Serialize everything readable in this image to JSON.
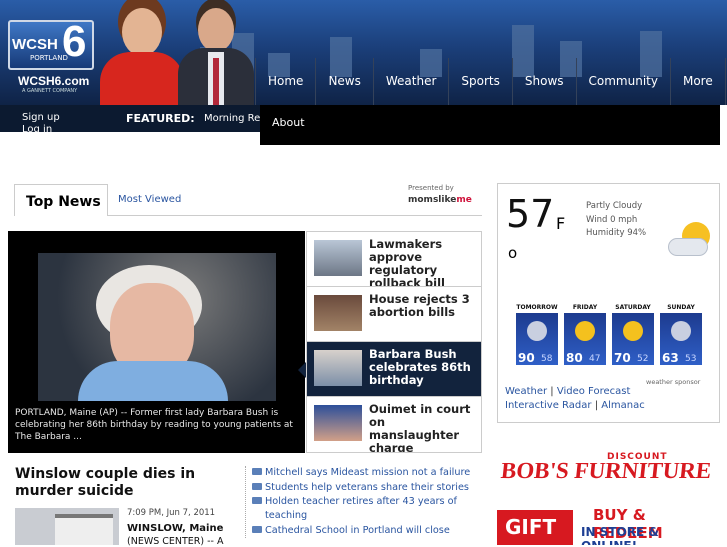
{
  "header": {
    "call_letters": "WCSH",
    "channel": "6",
    "city": "PORTLAND",
    "url": "WCSH6.com",
    "company": "A GANNETT COMPANY"
  },
  "nav": {
    "items": [
      "Home",
      "News",
      "Weather",
      "Sports",
      "Shows",
      "Community",
      "More"
    ],
    "submenu_item": "About"
  },
  "topbar": {
    "signup": "Sign up",
    "login": "Log in",
    "featured_label": "FEATURED:",
    "featured_item": "Morning Rep"
  },
  "tabs": {
    "top_news": "Top News",
    "most_viewed": "Most Viewed",
    "presented_by": "Presented by",
    "sponsor": "momslike",
    "sponsor_suffix": "me"
  },
  "feature": {
    "caption": "PORTLAND, Maine (AP) -- Former first lady Barbara Bush is celebrating her 86th birthday by reading to young patients at The Barbara ..."
  },
  "headlines": [
    {
      "text": "Lawmakers approve regulatory rollback bill",
      "active": false
    },
    {
      "text": "House rejects 3 abortion bills",
      "active": false
    },
    {
      "text": "Barbara Bush celebrates 86th birthday",
      "active": true
    },
    {
      "text": "Ouimet in court on manslaughter charge",
      "active": false
    }
  ],
  "story": {
    "headline": "Winslow couple dies in murder suicide",
    "date": "7:09 PM, Jun 7, 2011",
    "location": "WINSLOW, Maine",
    "source": "(NEWS CENTER) -- A"
  },
  "links": [
    "Mitchell says Mideast mission not a failure",
    "Students help veterans share their stories",
    "Holden teacher retires after 43 years of teaching",
    "Cathedral School in Portland will close"
  ],
  "weather": {
    "temp": "57",
    "unit": "F",
    "degree": "o",
    "condition": "Partly Cloudy",
    "wind": "Wind 0 mph",
    "humidity": "Humidity 94%",
    "forecast": [
      {
        "day": "TOMORROW",
        "hi": "90",
        "lo": "58",
        "icon": "storm-icon"
      },
      {
        "day": "FRIDAY",
        "hi": "80",
        "lo": "47",
        "icon": "sun-icon"
      },
      {
        "day": "SATURDAY",
        "hi": "70",
        "lo": "52",
        "icon": "sun-icon"
      },
      {
        "day": "SUNDAY",
        "hi": "63",
        "lo": "53",
        "icon": "storm-icon"
      }
    ],
    "sponsor": "weather sponsor",
    "link_weather": "Weather",
    "link_video": "Video Forecast",
    "link_radar": "Interactive Radar",
    "link_almanac": "Almanac",
    "separator": "|"
  },
  "ad": {
    "discount": "DISCOUNT",
    "brand": "BOB'S FURNITURE",
    "gift": "GIFT",
    "buy": "BUY & REDEEM",
    "store": "IN STORE & ONLINE!"
  },
  "colors": {
    "link": "#2a55a0",
    "nav_bg": "#0f2346",
    "active_headline": "#12233d",
    "ad_red": "#d71920"
  }
}
